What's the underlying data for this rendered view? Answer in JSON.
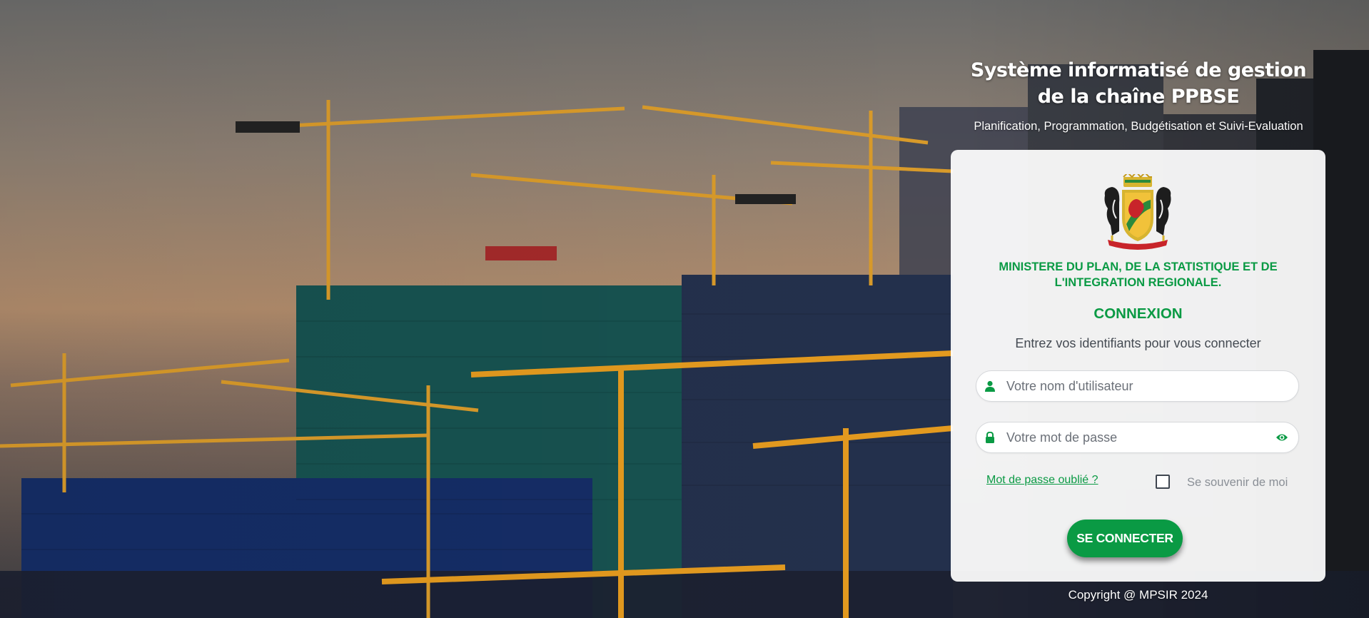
{
  "header": {
    "title": "Système informatisé de gestion de la chaîne PPBSE",
    "subtitle": "Planification, Programmation, Budgétisation et Suivi-Evaluation"
  },
  "card": {
    "ministry": "MINISTERE DU PLAN, DE LA STATISTIQUE ET DE L'INTEGRATION REGIONALE.",
    "heading": "CONNEXION",
    "instructions": "Entrez vos identifiants pour vous connecter",
    "username": {
      "placeholder": "Votre nom d'utilisateur",
      "value": "",
      "icon": "user-icon"
    },
    "password": {
      "placeholder": "Votre mot de passe",
      "value": "",
      "icon": "lock-icon",
      "toggle_icon": "eye-icon"
    },
    "forgot_link": "Mot de passe oublié ?",
    "remember_me": {
      "label": "Se souvenir de moi",
      "checked": false
    },
    "submit_label": "SE CONNECTER"
  },
  "footer": {
    "copyright": "Copyright @ MPSIR 2024"
  },
  "colors": {
    "accent": "#0a9a44",
    "card_background": "#f4f4f4",
    "text_muted": "#8a8f96"
  }
}
